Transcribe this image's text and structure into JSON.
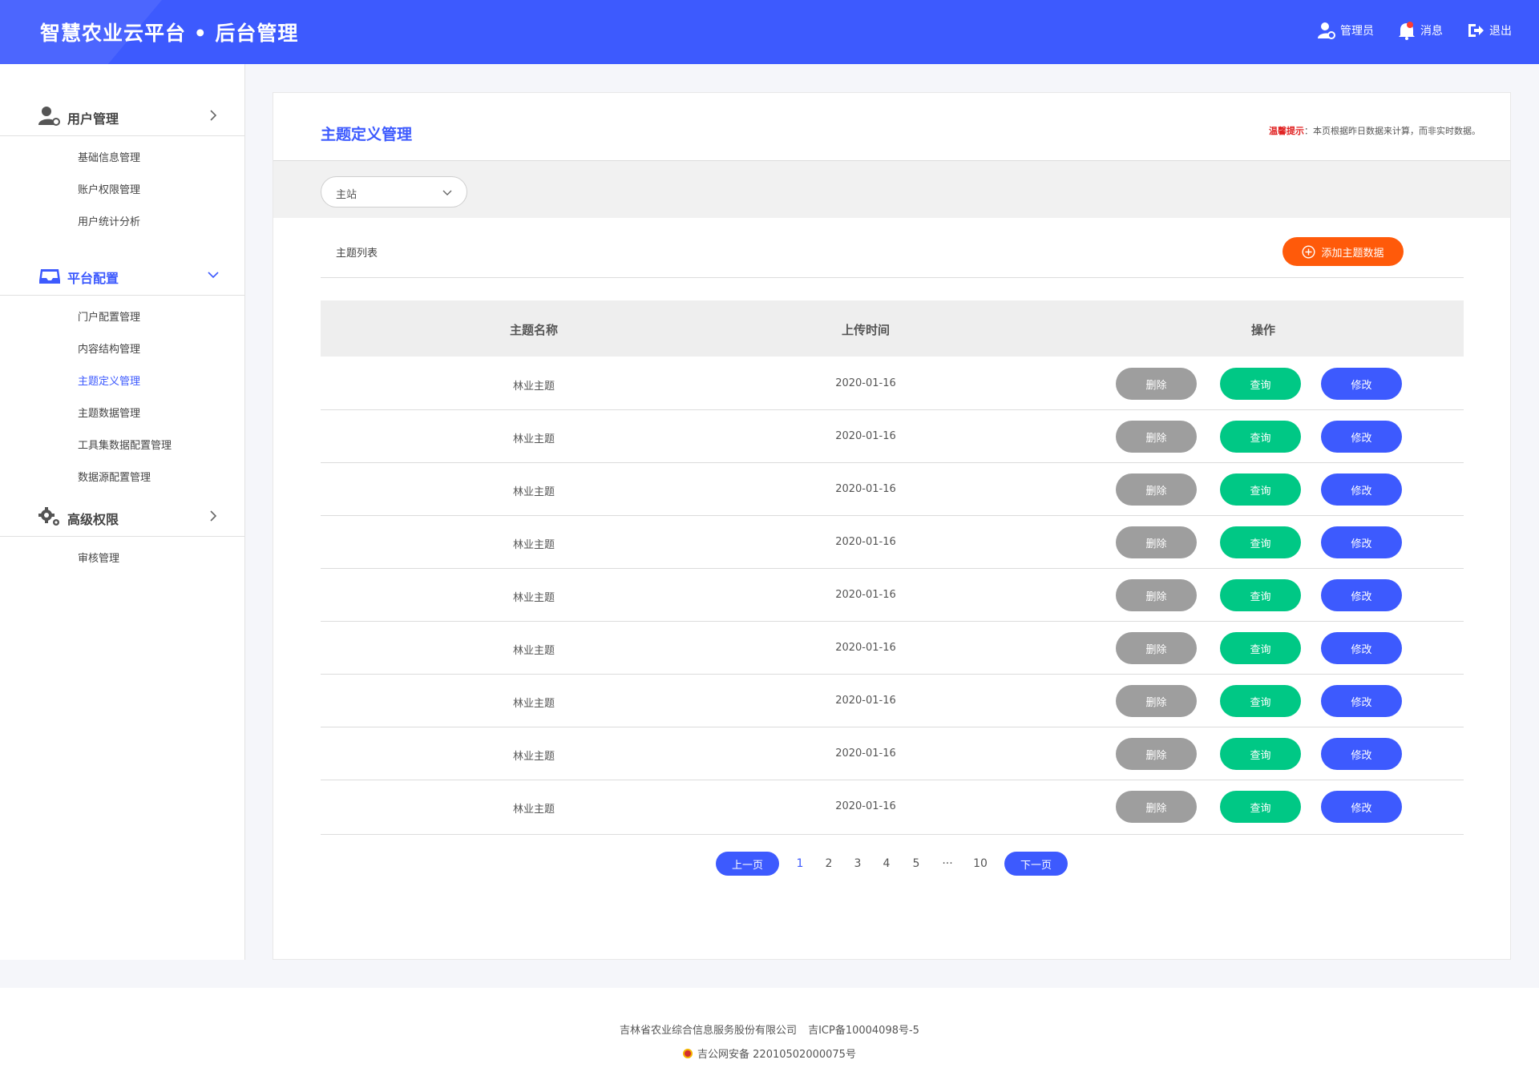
{
  "header": {
    "title": "智慧农业云平台 • 后台管理",
    "admin_label": "管理员",
    "message_label": "消息",
    "logout_label": "退出"
  },
  "sidebar": {
    "groups": [
      {
        "label": "用户管理",
        "icon": "user-gear-icon",
        "expanded": false,
        "items": [
          "基础信息管理",
          "账户权限管理",
          "用户统计分析"
        ]
      },
      {
        "label": "平台配置",
        "icon": "inbox-icon",
        "expanded": true,
        "items": [
          "门户配置管理",
          "内容结构管理",
          "主题定义管理",
          "主题数据管理",
          "工具集数据配置管理",
          "数据源配置管理"
        ]
      },
      {
        "label": "高级权限",
        "icon": "gears-icon",
        "expanded": false,
        "items": [
          "审核管理"
        ]
      }
    ],
    "active_item": "主题定义管理"
  },
  "main": {
    "title": "主题定义管理",
    "tip_key": "温馨提示",
    "tip_text": "：本页根据昨日数据来计算，而非实时数据。",
    "site_select": {
      "value": "主站"
    },
    "list_label": "主题列表",
    "add_button": "添加主题数据",
    "table": {
      "headers": [
        "主题名称",
        "上传时间",
        "操作"
      ],
      "rows": [
        {
          "name": "林业主题",
          "date": "2020-01-16"
        },
        {
          "name": "林业主题",
          "date": "2020-01-16"
        },
        {
          "name": "林业主题",
          "date": "2020-01-16"
        },
        {
          "name": "林业主题",
          "date": "2020-01-16"
        },
        {
          "name": "林业主题",
          "date": "2020-01-16"
        },
        {
          "name": "林业主题",
          "date": "2020-01-16"
        },
        {
          "name": "林业主题",
          "date": "2020-01-16"
        },
        {
          "name": "林业主题",
          "date": "2020-01-16"
        },
        {
          "name": "林业主题",
          "date": "2020-01-16"
        }
      ],
      "actions": {
        "delete": "删除",
        "query": "查询",
        "edit": "修改"
      }
    },
    "pagination": {
      "prev": "上一页",
      "next": "下一页",
      "pages": [
        "1",
        "2",
        "3",
        "4",
        "5",
        "···",
        "10"
      ],
      "current": "1"
    }
  },
  "footer": {
    "company": "吉林省农业综合信息服务股份有限公司",
    "icp": "吉ICP备10004098号-5",
    "police": "吉公网安备 22010502000075号"
  },
  "colors": {
    "brand": "#3d5afe",
    "add": "#ff5a0a",
    "delete": "#9e9e9e",
    "query": "#00c885",
    "edit": "#3d5afe",
    "tip_key": "#e02020"
  }
}
